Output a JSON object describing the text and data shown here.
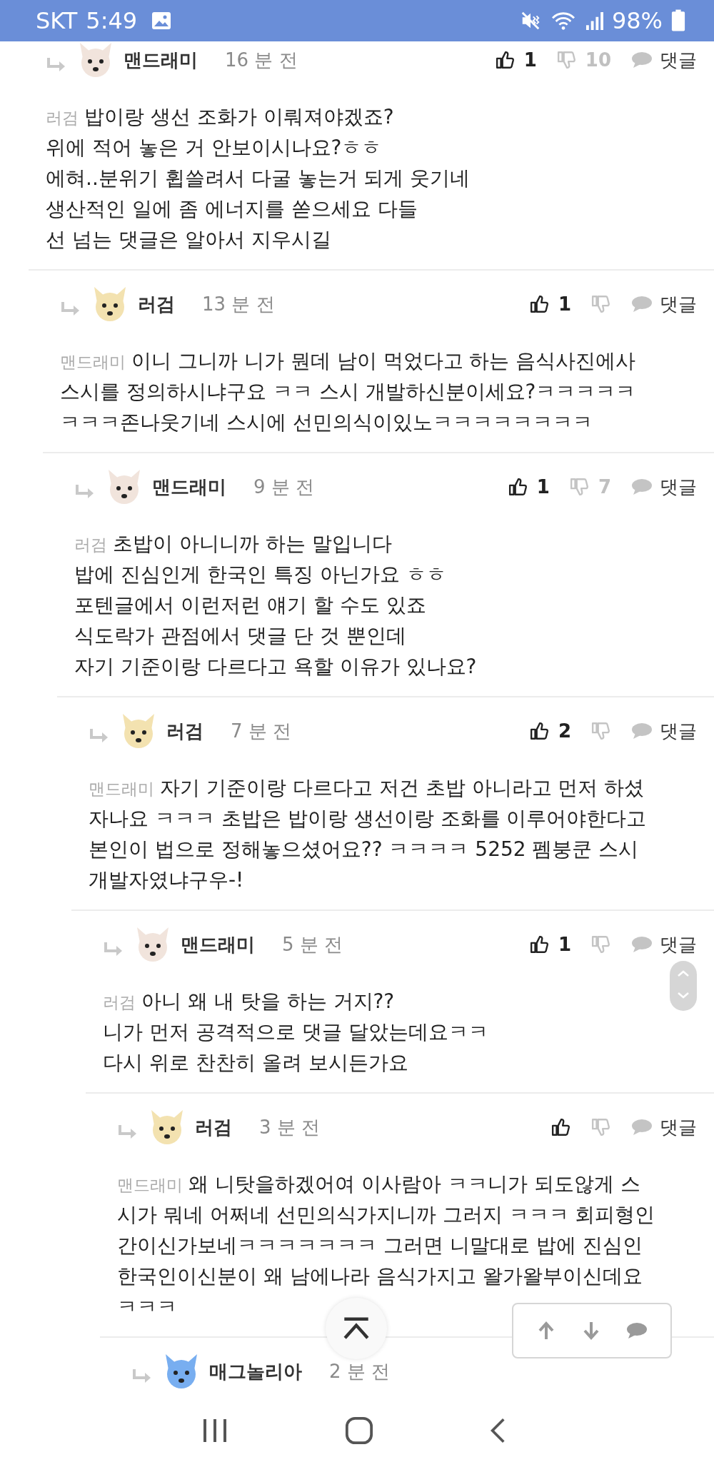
{
  "status_bar": {
    "carrier": "SKT",
    "time": "5:49",
    "battery": "98%"
  },
  "comments": [
    {
      "author": "맨드래미",
      "color": "#f1e4dc",
      "time": "16 분 전",
      "likes": "1",
      "dislikes": "10",
      "reply_label": "댓글",
      "mention": "러검",
      "lines": [
        "밥이랑 생선 조화가 이뤄져야겠죠?",
        "위에 적어 놓은 거 안보이시나요?ㅎㅎ",
        "에혀..분위기 휩쓸려서 다굴 놓는거 되게 웃기네",
        "생산적인 일에 좀 에너지를 쏟으세요 다들",
        "선 넘는 댓글은 알아서 지우시길"
      ],
      "children": [
        {
          "author": "러검",
          "color": "#f3e2b0",
          "time": "13 분 전",
          "likes": "1",
          "reply_label": "댓글",
          "mention": "맨드래미",
          "lines": [
            "이니 그니까 니가 뭔데 남이 먹었다고 하는 음식사진에사",
            "스시를 정의하시냐구요 ㅋㅋ 스시 개발하신분이세요?ㅋㅋㅋㅋㅋ",
            "ㅋㅋㅋ존나웃기네 스시에 선민의식이있노ㅋㅋㅋㅋㅋㅋㅋㅋ"
          ],
          "children": [
            {
              "author": "맨드래미",
              "color": "#f1e4dc",
              "time": "9 분 전",
              "likes": "1",
              "dislikes": "7",
              "reply_label": "댓글",
              "mention": "러검",
              "lines": [
                "초밥이 아니니까 하는 말입니다",
                "밥에 진심인게 한국인 특징 아닌가요 ㅎㅎ",
                "포텐글에서 이런저런 얘기 할 수도 있죠",
                "식도락가 관점에서 댓글 단 것 뿐인데",
                "자기 기준이랑 다르다고 욕할 이유가 있나요?"
              ],
              "children": [
                {
                  "author": "러검",
                  "color": "#f3e2b0",
                  "time": "7 분 전",
                  "likes": "2",
                  "reply_label": "댓글",
                  "mention": "맨드래미",
                  "lines": [
                    "자기 기준이랑 다르다고 저건 초밥 아니라고 먼저 하셨",
                    "자나요 ㅋㅋㅋ 초밥은 밥이랑 생선이랑 조화를 이루어야한다고",
                    "본인이 법으로 정해놓으셨어요?? ㅋㅋㅋㅋ 5252 펨붕쿤 스시",
                    "개발자였냐구우-!"
                  ],
                  "children": [
                    {
                      "author": "맨드래미",
                      "color": "#f1e4dc",
                      "time": "5 분 전",
                      "likes": "1",
                      "reply_label": "댓글",
                      "mention": "러검",
                      "lines": [
                        "아니 왜 내 탓을 하는 거지??",
                        "니가 먼저 공격적으로 댓글 달았는데요ㅋㅋ",
                        "다시 위로 찬찬히 올려 보시든가요"
                      ],
                      "children": [
                        {
                          "author": "러검",
                          "color": "#f3e2b0",
                          "time": "3 분 전",
                          "reply_label": "댓글",
                          "mention": "맨드래미",
                          "lines": [
                            "왜 니탓을하겠어여 이사람아 ㅋㅋ니가 되도않게 스",
                            "시가 뭐네 어쩌네 선민의식가지니까 그러지 ㅋㅋㅋ 회피형인",
                            "간이신가보네ㅋㅋㅋㅋㅋㅋㅋ 그러면 니말대로 밥에 진심인",
                            "한국인이신분이 왜 남에나라 음식가지고 왈가왈부이신데요",
                            "ㅋㅋㅋ"
                          ],
                          "children": [
                            {
                              "author": "매그놀리아",
                              "color": "#78aef0",
                              "time": "2 분 전"
                            }
                          ]
                        }
                      ]
                    }
                  ]
                }
              ]
            }
          ]
        }
      ]
    }
  ]
}
